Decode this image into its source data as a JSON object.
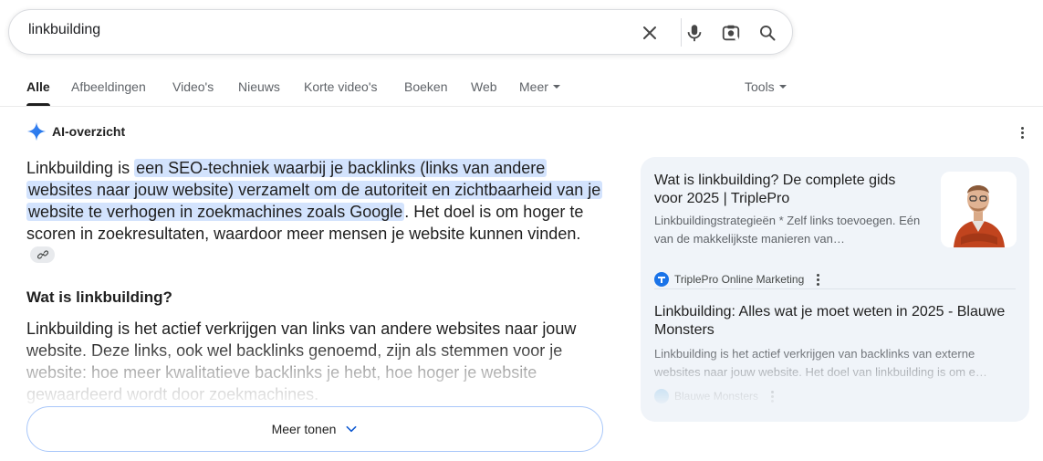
{
  "search": {
    "query": "linkbuilding"
  },
  "tabs": [
    {
      "label": "Alle"
    },
    {
      "label": "Afbeeldingen"
    },
    {
      "label": "Video's"
    },
    {
      "label": "Nieuws"
    },
    {
      "label": "Korte video's"
    },
    {
      "label": "Boeken"
    },
    {
      "label": "Web"
    },
    {
      "label": "Meer"
    }
  ],
  "tools_label": "Tools",
  "ai_overview": {
    "label": "AI-overzicht",
    "intro_before": "Linkbuilding is ",
    "intro_highlight": "een SEO-techniek waarbij je backlinks (links van andere websites naar jouw website) verzamelt om de autoriteit en zichtbaarheid van je website te verhogen in zoekmachines zoals Google",
    "intro_after": ". Het doel is om hoger te scoren in zoekresultaten, waardoor meer mensen je website kunnen vinden.",
    "heading": "Wat is linkbuilding?",
    "paragraph": "Linkbuilding is het actief verkrijgen van links van andere websites naar jouw website. Deze links, ook wel backlinks genoemd, zijn als stemmen voor je website: hoe meer kwalitatieve backlinks je hebt, hoe hoger je website gewaardeerd wordt door zoekmachines.",
    "more_label": "Meer tonen"
  },
  "sources": [
    {
      "title": "Wat is linkbuilding? De complete gids voor 2025 | TriplePro",
      "snippet": "Linkbuildingstrategieën * Zelf links toevoegen. Eén van de makkelijkste manieren van…",
      "site": "TriplePro Online Marketing"
    },
    {
      "title": "Linkbuilding: Alles wat je moet weten in 2025 - Blauwe Monsters",
      "snippet": "Linkbuilding is het actief verkrijgen van backlinks van externe websites naar jouw website. Het doel van linkbuilding is om e…",
      "site": "Blauwe Monsters"
    }
  ],
  "colors": {
    "accent": "#1a73e8",
    "highlight": "#d3e3fd",
    "panel_bg": "#f0f4f9"
  }
}
